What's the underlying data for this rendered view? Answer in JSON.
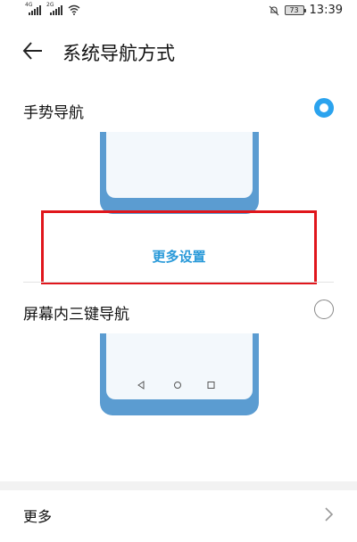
{
  "status_bar": {
    "sim1_tag": "4G",
    "sim2_tag": "2G",
    "battery_level": "73",
    "time": "13:39",
    "icons": [
      "signal-icon",
      "signal-icon",
      "wifi-icon",
      "mute-bell-icon",
      "battery-icon"
    ]
  },
  "header": {
    "back_icon": "back-arrow-icon",
    "title": "系统导航方式"
  },
  "options": [
    {
      "label": "手势导航",
      "selected": true
    },
    {
      "label": "屏幕内三键导航",
      "selected": false
    }
  ],
  "more_settings": {
    "label": "更多设置",
    "highlight_color": "#e0161c"
  },
  "footer": {
    "more_label": "更多",
    "chevron_icon": "chevron-right-icon"
  },
  "colors": {
    "accent": "#2ba3ee",
    "phone_frame": "#5b9cd1",
    "link": "#2a9ad9"
  }
}
